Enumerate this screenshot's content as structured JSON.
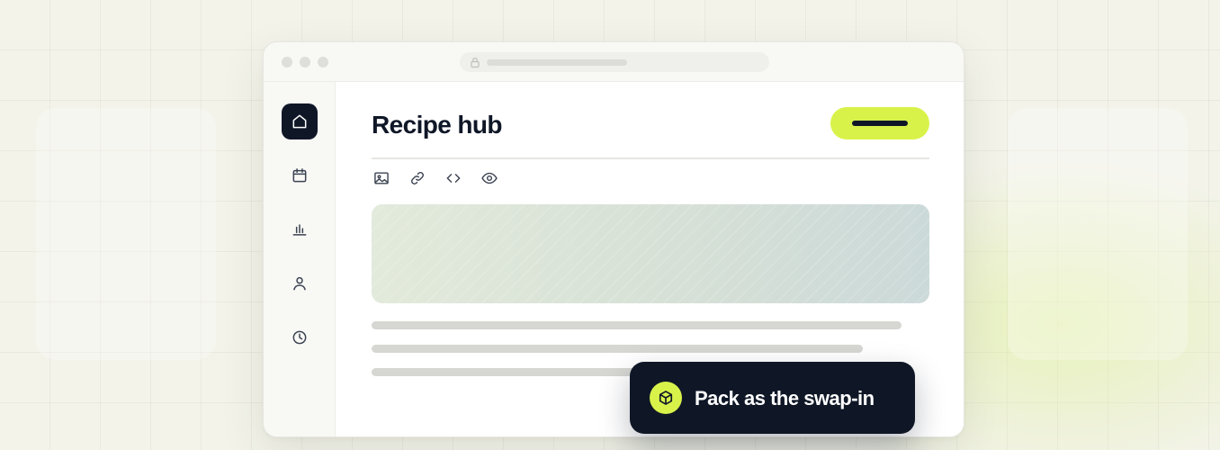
{
  "page": {
    "title": "Recipe hub"
  },
  "browser": {
    "window_controls": [
      "close",
      "minimize",
      "maximize"
    ],
    "address_bar_icon": "lock-icon"
  },
  "sidebar": {
    "items": [
      {
        "id": "home",
        "icon": "home-icon",
        "active": true
      },
      {
        "id": "calendar",
        "icon": "calendar-icon",
        "active": false
      },
      {
        "id": "stats",
        "icon": "bar-chart-icon",
        "active": false
      },
      {
        "id": "profile",
        "icon": "user-icon",
        "active": false
      },
      {
        "id": "history",
        "icon": "clock-icon",
        "active": false
      }
    ]
  },
  "toolbar": {
    "tools": [
      "image-icon",
      "link-icon",
      "code-icon",
      "eye-icon"
    ]
  },
  "toast": {
    "icon": "package-icon",
    "message": "Pack as the swap-in"
  },
  "colors": {
    "accent": "#d9f24a",
    "dark": "#0f1727",
    "background": "#f3f3ea"
  }
}
